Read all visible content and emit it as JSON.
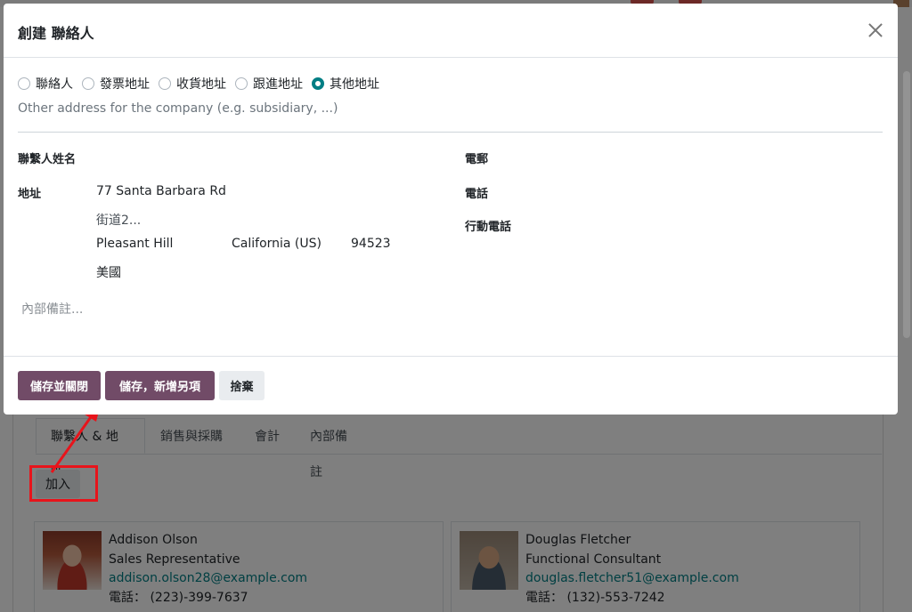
{
  "background": {
    "tabs": [
      "聯繫人 & 地址",
      "銷售與採購",
      "會計",
      "內部備註"
    ],
    "add_button": "加入",
    "contacts": [
      {
        "name": "Addison Olson",
        "title": "Sales Representative",
        "email": "addison.olson28@example.com",
        "phone": "電話：  (223)-399-7637"
      },
      {
        "name": "Douglas Fletcher",
        "title": "Functional Consultant",
        "email": "douglas.fletcher51@example.com",
        "phone": "電話：  (132)-553-7242"
      }
    ]
  },
  "modal": {
    "title": "創建 聯絡人",
    "address_types": [
      {
        "label": "聯絡人",
        "checked": false
      },
      {
        "label": "發票地址",
        "checked": false
      },
      {
        "label": "收貨地址",
        "checked": false
      },
      {
        "label": "跟進地址",
        "checked": false
      },
      {
        "label": "其他地址",
        "checked": true
      }
    ],
    "type_hint": "Other address for the company (e.g. subsidiary, ...)",
    "fields": {
      "contact_name_label": "聯繫人姓名",
      "address_label": "地址",
      "street": "77 Santa Barbara Rd",
      "street2_placeholder": "街道2...",
      "city": "Pleasant Hill",
      "state": "California (US)",
      "zip": "94523",
      "country": "美國",
      "email_label": "電郵",
      "phone_label": "電話",
      "mobile_label": "行動電話",
      "notes_placeholder": "內部備註..."
    },
    "footer": {
      "save_close": "儲存並關閉",
      "save_new": "儲存，新增另項",
      "discard": "捨棄"
    }
  },
  "colors": {
    "primary": "#714b67",
    "accent": "#017e84",
    "annotation": "#e8141b"
  }
}
